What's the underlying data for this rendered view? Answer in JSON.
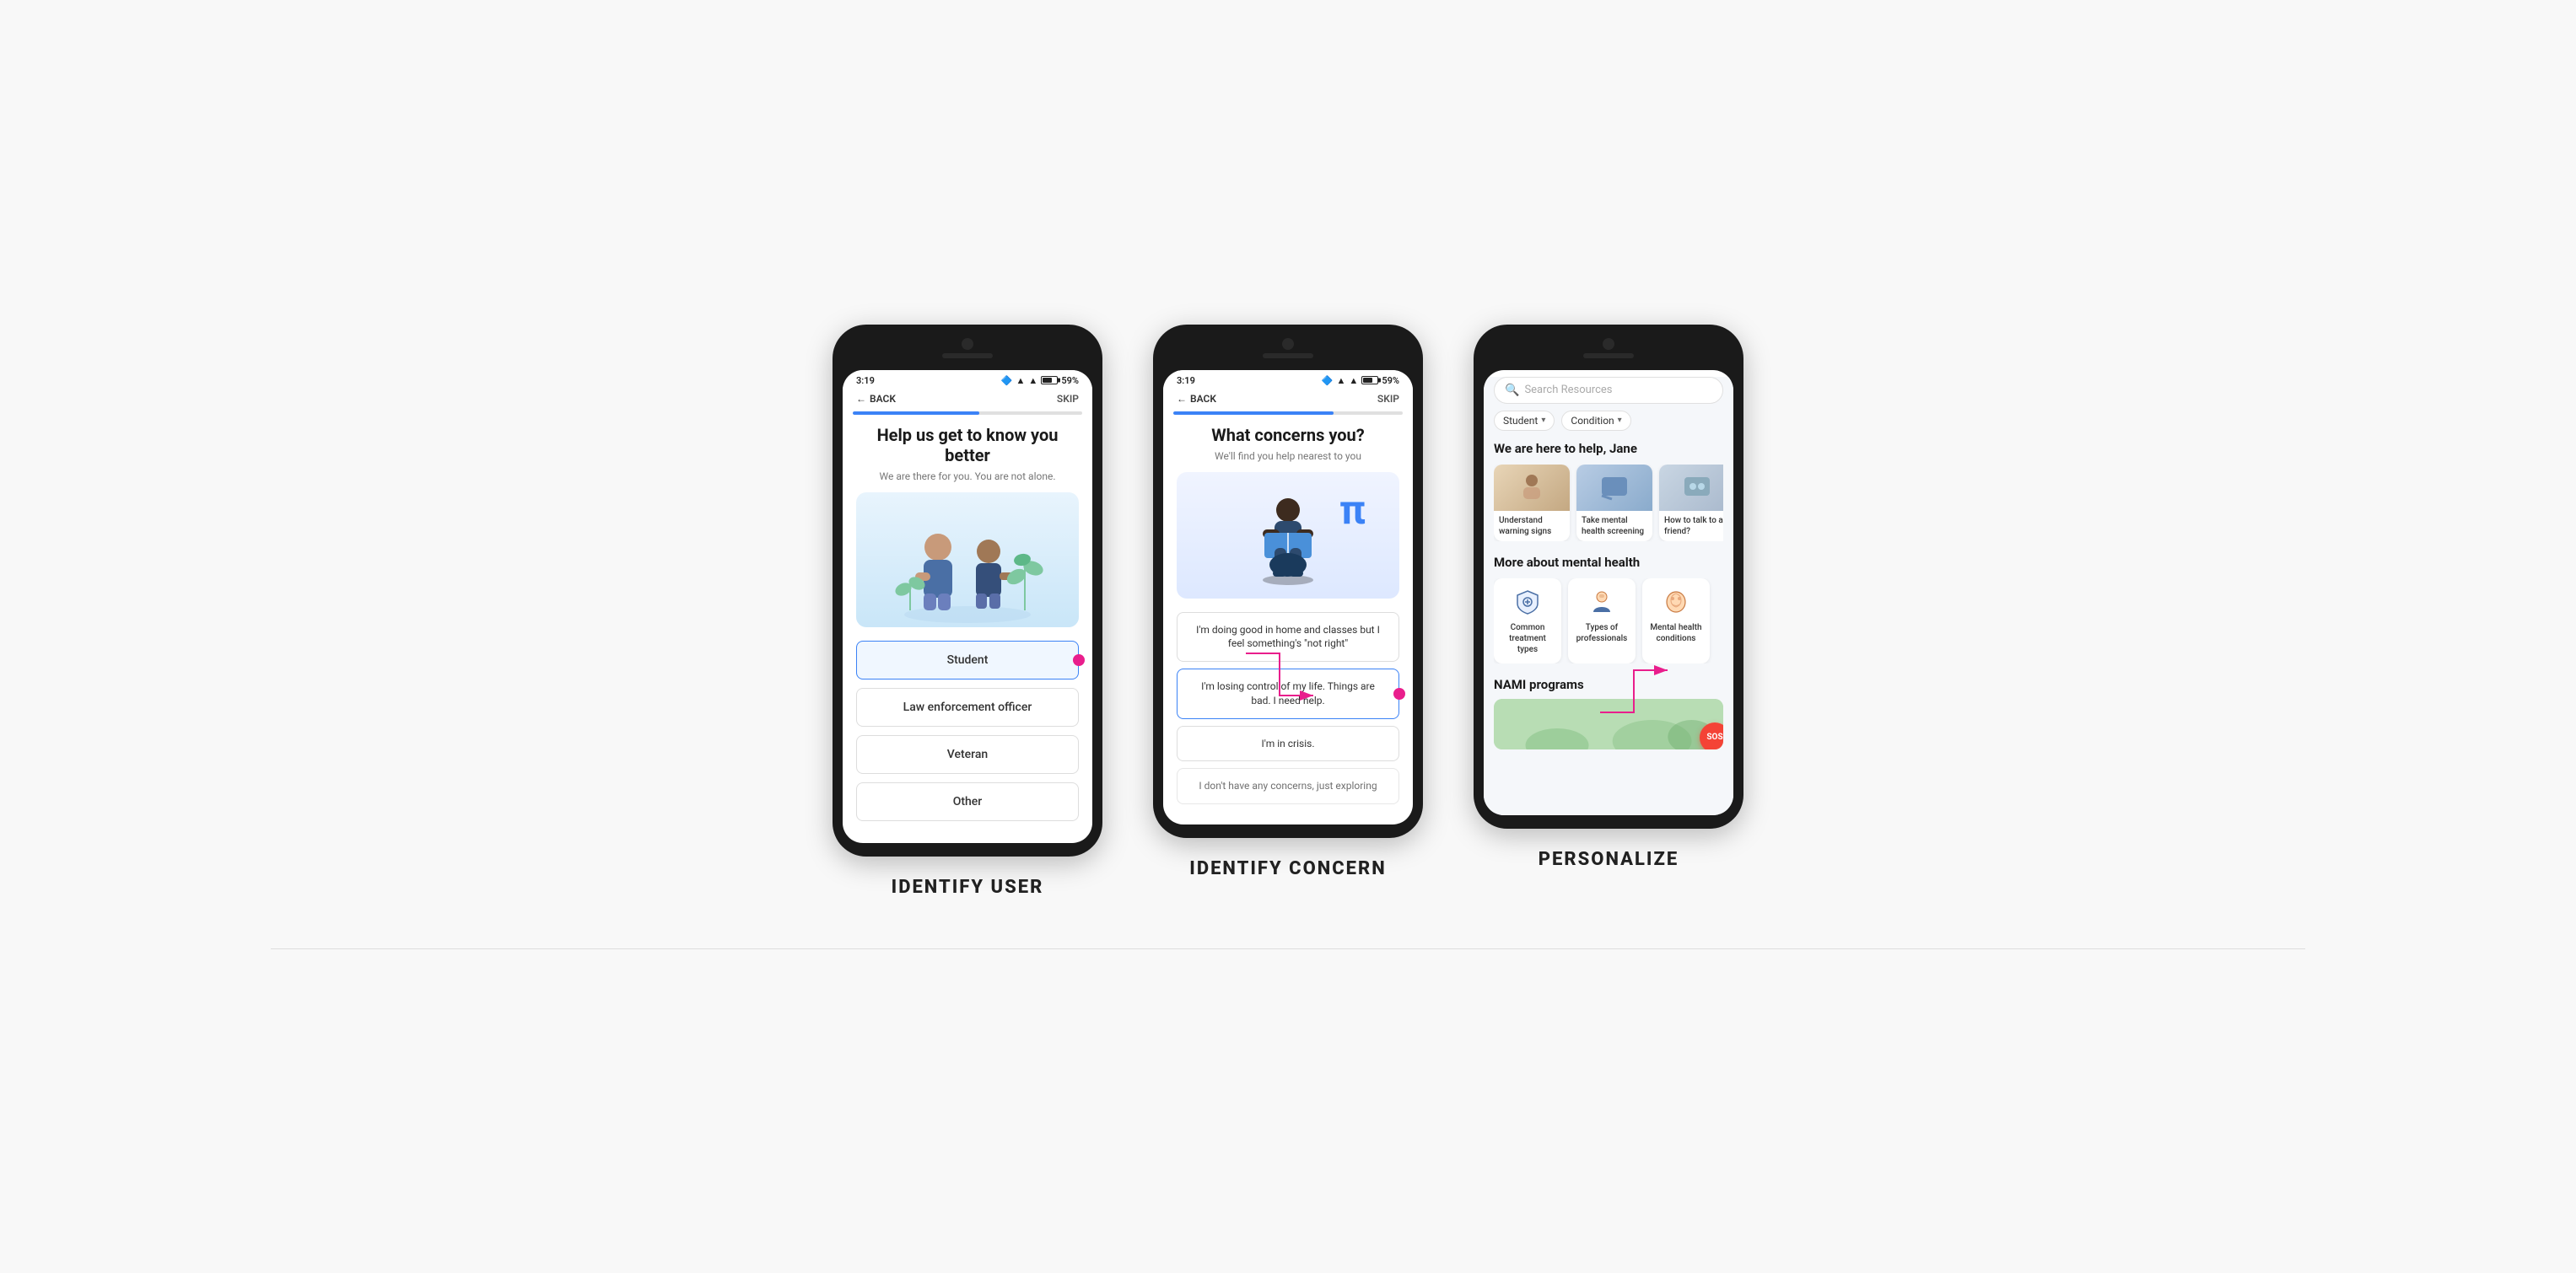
{
  "phones": [
    {
      "id": "phone1",
      "label": "IDENTIFY USER",
      "statusTime": "3:19",
      "battery": "59%",
      "navBack": "BACK",
      "navSkip": "SKIP",
      "progressPercent": 55,
      "title": "Help us get to know you better",
      "subtitle": "We are there for you. You are not alone.",
      "options": [
        {
          "text": "Student",
          "selected": true
        },
        {
          "text": "Law enforcement officer",
          "selected": false
        },
        {
          "text": "Veteran",
          "selected": false
        },
        {
          "text": "Other",
          "selected": false
        }
      ]
    },
    {
      "id": "phone2",
      "label": "IDENTIFY CONCERN",
      "statusTime": "3:19",
      "battery": "59%",
      "navBack": "BACK",
      "navSkip": "SKIP",
      "progressPercent": 70,
      "title": "What concerns you?",
      "subtitle": "We'll find you help nearest to you",
      "concerns": [
        {
          "text": "I'm doing good in home and classes but I feel something's \"not right\"",
          "active": false
        },
        {
          "text": "I'm losing control of my life. Things are bad. I need help.",
          "active": true
        },
        {
          "text": "I'm in crisis.",
          "active": false
        },
        {
          "text": "I don't have any concerns, just exploring",
          "active": false,
          "faded": true
        }
      ]
    },
    {
      "id": "phone3",
      "label": "PERSONALIZE",
      "searchPlaceholder": "Search Resources",
      "filters": [
        {
          "text": "Student"
        },
        {
          "text": "Condition"
        }
      ],
      "heroTitle": "We are here to help, Jane",
      "resourceCards": [
        {
          "text": "Understand warning signs",
          "colorClass": "warm"
        },
        {
          "text": "Take mental health screening",
          "colorClass": "cool"
        },
        {
          "text": "How to talk to a friend?",
          "colorClass": "warm"
        }
      ],
      "moreTitle": "More about mental health",
      "iconCards": [
        {
          "text": "Common treatment types",
          "icon": "🛡️"
        },
        {
          "text": "Types of professionals",
          "icon": "👤"
        },
        {
          "text": "Mental health conditions",
          "icon": "🧠"
        }
      ],
      "namiTitle": "NAMI programs",
      "sosLabel": "SOS"
    }
  ],
  "icons": {
    "backArrow": "←",
    "searchMagnifier": "🔍",
    "chevronDown": "▾"
  }
}
